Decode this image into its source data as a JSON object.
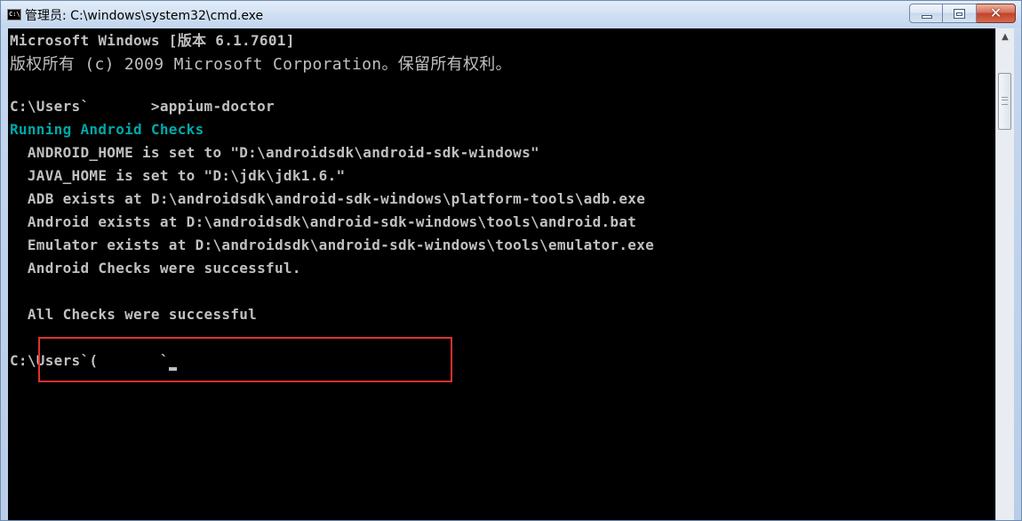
{
  "window": {
    "title": "管理员: C:\\windows\\system32\\cmd.exe",
    "app_icon_text": "C:\\",
    "close_glyph": "✕",
    "scroll_up_glyph": "▲"
  },
  "console": {
    "lines": [
      "Microsoft Windows [版本 6.1.7601]",
      "版权所有 (c) 2009 Microsoft Corporation。保留所有权利。",
      "",
      "C:\\Users`       >appium-doctor",
      "Running Android Checks",
      "  ANDROID_HOME is set to \"D:\\androidsdk\\android-sdk-windows\"",
      "  JAVA_HOME is set to \"D:\\jdk\\jdk1.6.\"",
      "  ADB exists at D:\\androidsdk\\android-sdk-windows\\platform-tools\\adb.exe",
      "  Android exists at D:\\androidsdk\\android-sdk-windows\\tools\\android.bat",
      "  Emulator exists at D:\\androidsdk\\android-sdk-windows\\tools\\emulator.exe",
      "  Android Checks were successful.",
      "",
      "  All Checks were successful",
      "",
      "C:\\Users`(       `"
    ]
  },
  "colors": {
    "console_bg": "#000000",
    "console_text": "#c0c0c0",
    "section_heading": "#00a8a8",
    "annotation_box": "#e03030"
  }
}
